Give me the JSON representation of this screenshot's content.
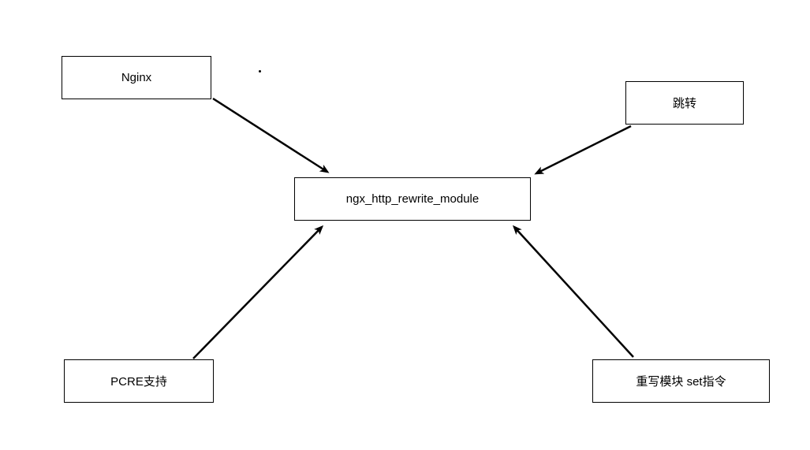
{
  "nodes": {
    "nginx": "Nginx",
    "jump": "跳转",
    "center": "ngx_http_rewrite_module",
    "pcre": "PCRE支持",
    "set": "重写模块 set指令"
  }
}
